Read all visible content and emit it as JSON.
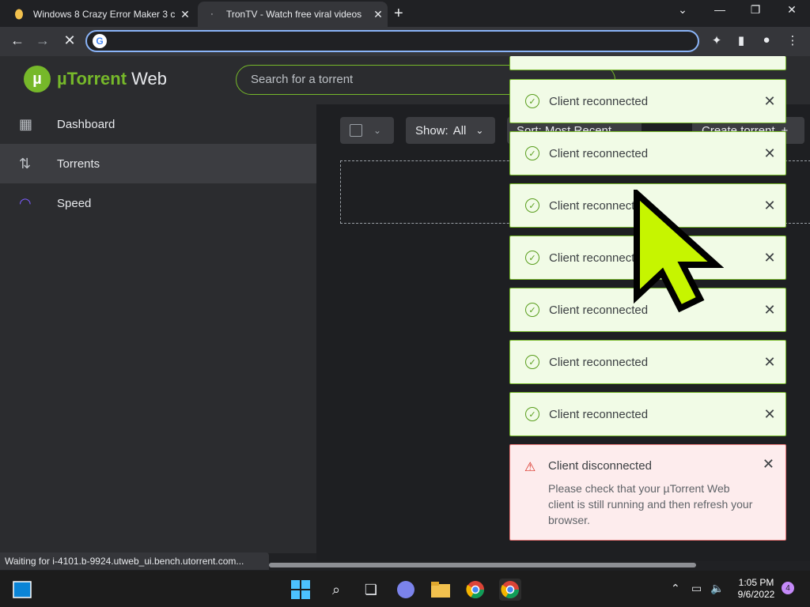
{
  "browser": {
    "tabs": [
      {
        "title": "Windows 8 Crazy Error Maker 3 c",
        "close": "✕"
      },
      {
        "title": "TronTV - Watch free viral videos",
        "close": "✕"
      }
    ],
    "new_tab": "+",
    "address": "",
    "status_text": "Waiting for i-4101.b-9924.utweb_ui.bench.utorrent.com..."
  },
  "app": {
    "logo_mu": "µ",
    "logo_name": "µTorrent",
    "logo_web": " Web",
    "search_placeholder": "Search for a torrent",
    "sidebar": [
      {
        "label": "Dashboard",
        "icon": "dashboard-icon"
      },
      {
        "label": "Torrents",
        "icon": "updown-arrows-icon"
      },
      {
        "label": "Speed",
        "icon": "speedometer-icon"
      }
    ],
    "controls": {
      "show_label": "Show:",
      "show_value": "All",
      "sort_label": "Sort: Most Recent",
      "create_label": "Create torrent"
    }
  },
  "notifications": [
    {
      "text": "Client reconnected"
    },
    {
      "text": "Client reconnected"
    },
    {
      "text": "Client reconnected"
    },
    {
      "text": "Client reconnected"
    },
    {
      "text": "Client reconnected"
    },
    {
      "text": "Client reconnected"
    },
    {
      "text": "Client reconnected"
    }
  ],
  "error": {
    "title": "Client disconnected",
    "body": "Please check that your µTorrent Web client is still running and then refresh your browser."
  },
  "taskbar": {
    "time": "1:05 PM",
    "date": "9/6/2022",
    "badge": "4"
  },
  "colors": {
    "brand_green": "#76b82a",
    "toast_bg": "#f1fbe6",
    "error_bg": "#fdeced",
    "cursor_fill": "#c6f500"
  }
}
